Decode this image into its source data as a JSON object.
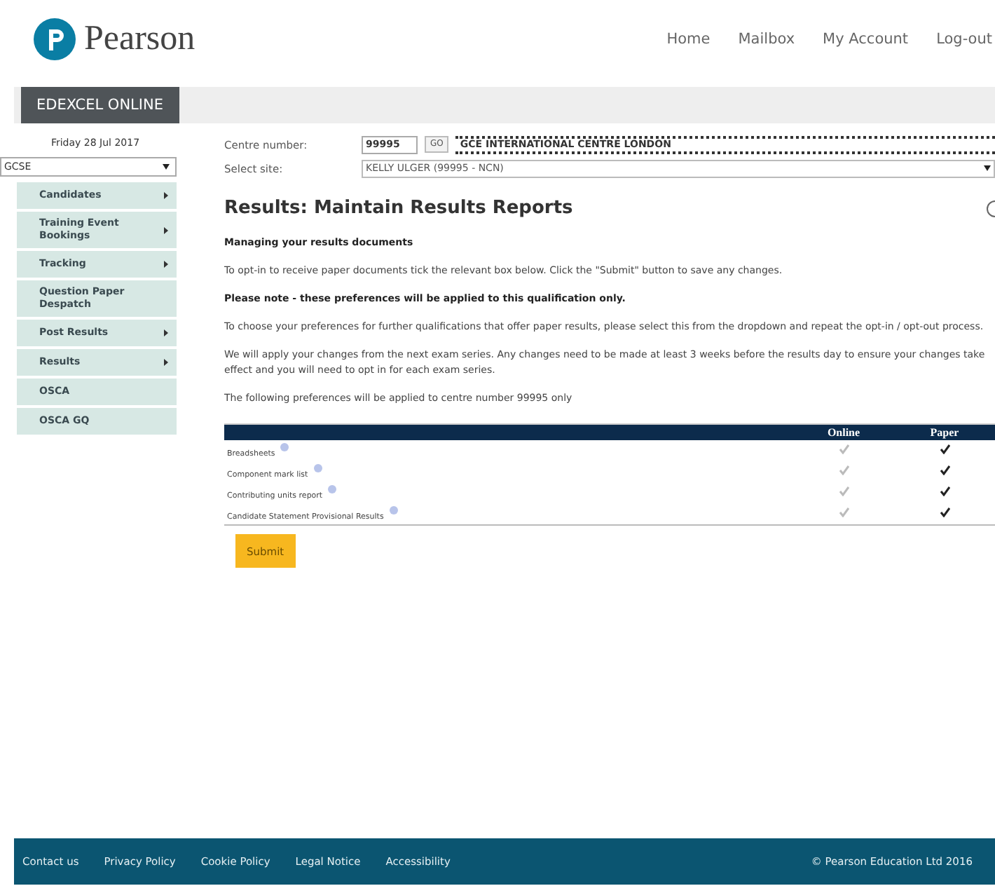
{
  "header": {
    "logo_text": "Pearson",
    "nav": [
      "Home",
      "Mailbox",
      "My Account",
      "Log-out"
    ]
  },
  "brand_tab": "EDEXCEL ONLINE",
  "sidebar": {
    "date": "Friday 28 Jul 2017",
    "qualification": "GCSE",
    "items": [
      {
        "label": "Candidates",
        "has_submenu": true
      },
      {
        "label": "Training Event Bookings",
        "has_submenu": true
      },
      {
        "label": "Tracking",
        "has_submenu": true
      },
      {
        "label": "Question Paper Despatch",
        "has_submenu": false
      },
      {
        "label": "Post Results",
        "has_submenu": true
      },
      {
        "label": "Results",
        "has_submenu": true
      },
      {
        "label": "OSCA",
        "has_submenu": false
      },
      {
        "label": "OSCA GQ",
        "has_submenu": false
      }
    ]
  },
  "centre": {
    "label": "Centre number:",
    "value": "99995",
    "go": "GO",
    "name": "GCE INTERNATIONAL CENTRE LONDON",
    "site_label": "Select site:",
    "site_value": "KELLY ULGER (99995 - NCN)"
  },
  "page_title": "Results: Maintain Results Reports",
  "paragraphs": [
    {
      "text": "Managing your results documents",
      "bold": true
    },
    {
      "text": "To opt-in to receive paper documents tick the relevant box below. Click the \"Submit\" button to save any changes.",
      "bold": false
    },
    {
      "text": "Please note - these preferences will be applied to this qualification only.",
      "bold": true
    },
    {
      "text": "To choose your preferences for further qualifications that offer paper results, please select this from the dropdown and repeat the opt-in / opt-out process.",
      "bold": false
    },
    {
      "text": "We will apply your changes from the next exam series. Any changes need to be made at least 3 weeks before the results day to ensure your changes take effect and you will need to opt in for each exam series.",
      "bold": false
    },
    {
      "text": "The following preferences will be applied to centre number 99995 only",
      "bold": false
    }
  ],
  "table": {
    "columns": [
      "Online",
      "Paper"
    ],
    "rows": [
      {
        "name": "Breadsheets",
        "online": {
          "checked": true,
          "disabled": true
        },
        "paper": {
          "checked": true,
          "disabled": false
        }
      },
      {
        "name": "Component mark list",
        "online": {
          "checked": true,
          "disabled": true
        },
        "paper": {
          "checked": true,
          "disabled": false
        }
      },
      {
        "name": "Contributing units report",
        "online": {
          "checked": true,
          "disabled": true
        },
        "paper": {
          "checked": true,
          "disabled": false
        }
      },
      {
        "name": "Candidate Statement Provisional Results",
        "online": {
          "checked": true,
          "disabled": true
        },
        "paper": {
          "checked": true,
          "disabled": false
        }
      }
    ]
  },
  "submit": "Submit",
  "footer": {
    "links": [
      "Contact us",
      "Privacy Policy",
      "Cookie Policy",
      "Legal Notice",
      "Accessibility"
    ],
    "copyright": "© Pearson Education Ltd 2016"
  }
}
